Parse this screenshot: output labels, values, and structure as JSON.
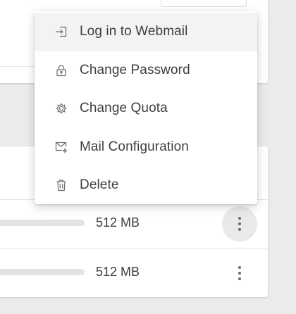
{
  "menu": {
    "items": [
      {
        "label": "Log in to Webmail",
        "icon": "login-icon"
      },
      {
        "label": "Change Password",
        "icon": "lock-icon"
      },
      {
        "label": "Change Quota",
        "icon": "gear-icon"
      },
      {
        "label": "Mail Configuration",
        "icon": "mail-settings-icon"
      },
      {
        "label": "Delete",
        "icon": "trash-icon"
      }
    ]
  },
  "accounts": {
    "rows": [
      {
        "quota": "512 MB"
      },
      {
        "quota": "512 MB"
      }
    ]
  },
  "colors": {
    "background": "#ebebeb",
    "card": "#ffffff",
    "text": "#3f3f3f",
    "icon": "#6b6b6b",
    "hover": "#f3f3f3"
  }
}
